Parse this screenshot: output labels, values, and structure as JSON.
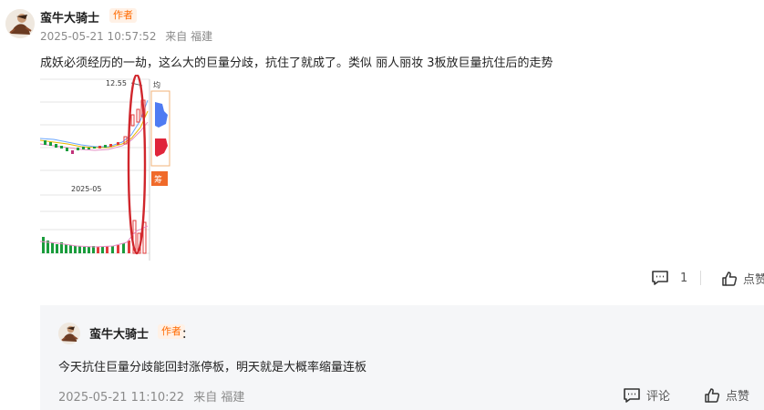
{
  "post": {
    "author_name": "蛮牛大骑士",
    "author_badge": "作者",
    "timestamp": "2025-05-21 10:57:52",
    "source": "来自 福建",
    "content": "成妖必须经历的一劫，这么大的巨量分歧，抗住了就成了。类似 丽人丽妆 3板放巨量抗住后的走势",
    "chart_image": {
      "price_label": "12.55",
      "date_label": "2025-05",
      "side_label_top": "均",
      "side_tag": "筹"
    },
    "actions": {
      "comment_count": "1",
      "like_label": "点赞"
    }
  },
  "reply": {
    "author_name": "蛮牛大骑士",
    "author_badge": "作者",
    "colon": "：",
    "content": "今天抗住巨量分歧能回封涨停板，明天就是大概率缩量连板",
    "timestamp": "2025-05-21 11:10:22",
    "source": "来自 福建",
    "actions": {
      "comment_label": "评论",
      "like_label": "点赞"
    }
  }
}
